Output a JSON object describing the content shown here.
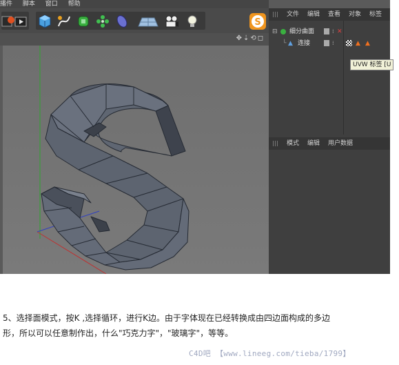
{
  "menubar": {
    "items": [
      "播件",
      "脚本",
      "窗口",
      "帮助"
    ]
  },
  "toolbar": {
    "icons": [
      "render-settings-icon",
      "render-view-icon",
      "cube-icon",
      "spline-pen-icon",
      "subdivision-icon",
      "array-icon",
      "deformer-icon",
      "floor-plane-icon",
      "camera-icon",
      "light-bulb-icon"
    ],
    "badge": "S"
  },
  "objects_panel": {
    "menu": [
      "文件",
      "编辑",
      "查看",
      "对象",
      "标签"
    ],
    "rows": [
      {
        "name": "细分曲面"
      },
      {
        "name": "连接"
      }
    ],
    "tooltip": "UVW 标签 [U"
  },
  "attributes_panel": {
    "menu": [
      "模式",
      "编辑",
      "用户数据"
    ]
  },
  "caption": {
    "line1": "5、选择面模式，按K ,选择循环，进行K边。由于字体现在已经转换成由四边面构成的多边",
    "line2": "形，所以可以任意制作出，什么\"巧克力字\"，\"玻璃字\"，等等。"
  },
  "watermark": "C4D吧 【www.lineeg.com/tieba/1799】",
  "colors": {
    "accent": "#f0951e",
    "mesh": "#5d6470",
    "axis_y": "#2fa52f",
    "axis_x": "#c03030",
    "axis_z": "#3040c0"
  }
}
